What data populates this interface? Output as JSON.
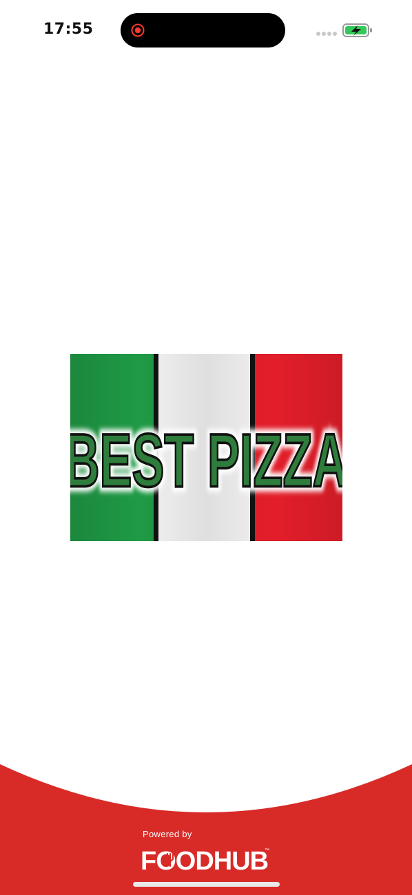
{
  "status_bar": {
    "time": "17:55",
    "icons": {
      "recording": "screen-record-icon",
      "signal": "signal-dots-icon",
      "battery": "battery-charging-icon"
    }
  },
  "splash": {
    "logo_text": "BEST PIZZA",
    "logo_colors": {
      "green": "#1f9a45",
      "white": "#f2f2f2",
      "red": "#e31e2a",
      "text_fill": "#2f7d3c"
    }
  },
  "footer": {
    "powered_by": "Powered by",
    "brand": "FOODHUB",
    "background": "#d82b27"
  }
}
